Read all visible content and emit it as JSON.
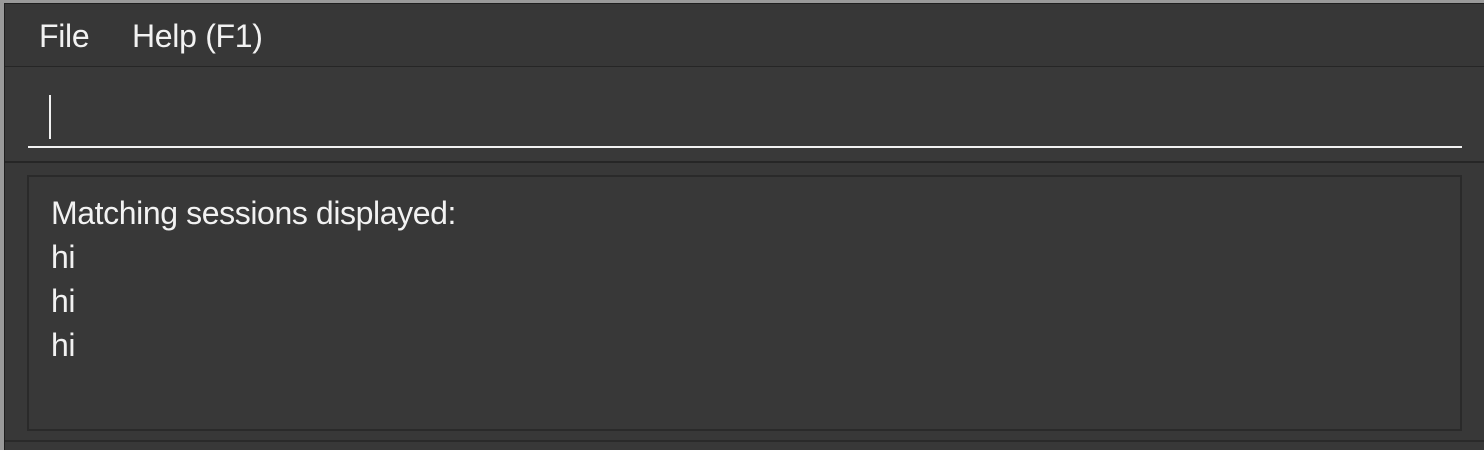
{
  "menu": {
    "items": [
      {
        "label": "File"
      },
      {
        "label": "Help (F1)"
      }
    ]
  },
  "command_box": {
    "value": "",
    "placeholder": ""
  },
  "result_display": {
    "lines": [
      "Matching sessions displayed:",
      "hi",
      "hi",
      "hi"
    ]
  },
  "colors": {
    "background": "#383838",
    "text": "#f2f2f2",
    "divider": "#262626"
  }
}
